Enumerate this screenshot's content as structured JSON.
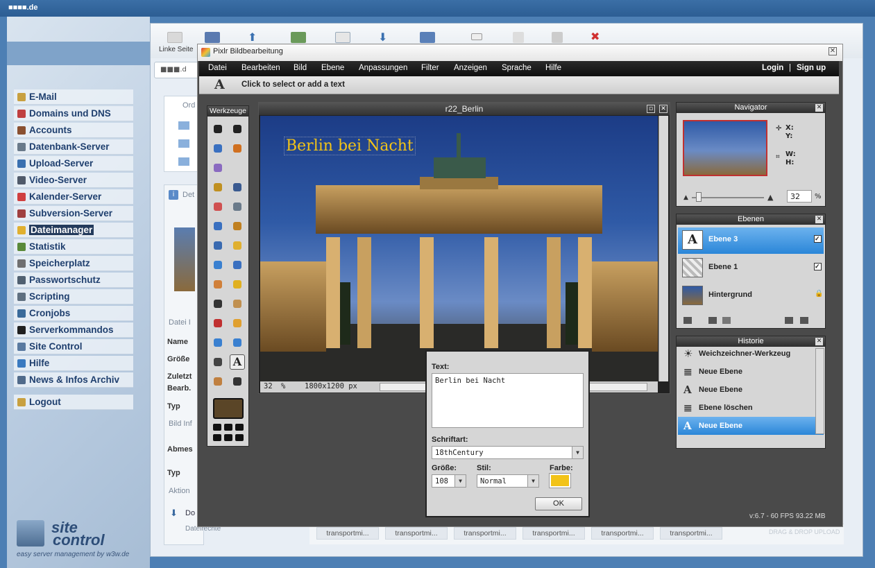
{
  "top_bar": {
    "domain": "■■■■.de"
  },
  "sidebar": {
    "items": [
      {
        "label": "E-Mail",
        "color": "#c8a040"
      },
      {
        "label": "Domains und DNS",
        "color": "#c04040"
      },
      {
        "label": "Accounts",
        "color": "#8a5030"
      },
      {
        "label": "Datenbank-Server",
        "color": "#6a7a8a"
      },
      {
        "label": "Upload-Server",
        "color": "#3a70b0"
      },
      {
        "label": "Video-Server",
        "color": "#505a6a"
      },
      {
        "label": "Kalender-Server",
        "color": "#d04040"
      },
      {
        "label": "Subversion-Server",
        "color": "#a04040"
      },
      {
        "label": "Dateimanager",
        "color": "#e0b030"
      },
      {
        "label": "Statistik",
        "color": "#5a8a3a"
      },
      {
        "label": "Speicherplatz",
        "color": "#707070"
      },
      {
        "label": "Passwortschutz",
        "color": "#506070"
      },
      {
        "label": "Scripting",
        "color": "#607080"
      },
      {
        "label": "Cronjobs",
        "color": "#3a6a9a"
      },
      {
        "label": "Serverkommandos",
        "color": "#202020"
      },
      {
        "label": "Site Control",
        "color": "#5a7aa0"
      },
      {
        "label": "Hilfe",
        "color": "#3a7ac0"
      },
      {
        "label": "News & Infos Archiv",
        "color": "#506a8a"
      }
    ],
    "logout": "Logout",
    "active": "Dateimanager"
  },
  "brand": {
    "line1": "site",
    "line2": "control",
    "tagline": "easy server management by w3w.de"
  },
  "filemanager": {
    "toolbar_label": "Linke Seite",
    "address_value": "■■■.d",
    "folder_label": "Ord",
    "details_label": "Det",
    "file_info": "Datei I",
    "fields": [
      "Name",
      "Größe",
      "Zuletzt",
      "Bearb.",
      "Typ"
    ],
    "image_info": "Bild Inf",
    "abmes": "Abmes",
    "typ2": "Typ",
    "aktion": "Aktion",
    "do": "Do",
    "dateirechte": "Dateirechte",
    "transports": [
      "transportmi...",
      "transportmi...",
      "transportmi...",
      "transportmi...",
      "transportmi...",
      "transportmi..."
    ],
    "dragdrop": "DRAG & DROP UPLOAD"
  },
  "pixlr": {
    "title": "Pixlr Bildbearbeitung",
    "menu": [
      "Datei",
      "Bearbeiten",
      "Bild",
      "Ebene",
      "Anpassungen",
      "Filter",
      "Anzeigen",
      "Sprache",
      "Hilfe"
    ],
    "login": "Login",
    "separator": "|",
    "signup": "Sign up",
    "hint": "Click to select or add a text",
    "tools_title": "Werkzeuge",
    "image_title": "r22_Berlin",
    "overlay_text": "Berlin bei Nacht",
    "zoom": "32",
    "zoom_unit": "%",
    "dimensions": "1800x1200 px",
    "version": "v:6.7 - 60 FPS 93.22 MB",
    "foreground_color": "#5a4527",
    "navigator": {
      "title": "Navigator",
      "x": "X:",
      "y": "Y:",
      "w": "W:",
      "h": "H:",
      "zoom": "32",
      "unit": "%"
    },
    "layers": {
      "title": "Ebenen",
      "items": [
        {
          "name": "Ebene 3",
          "selected": true,
          "icon": "text-icon"
        },
        {
          "name": "Ebene 1",
          "selected": false,
          "icon": "transparent-icon"
        },
        {
          "name": "Hintergrund",
          "selected": false,
          "icon": "image-icon"
        }
      ]
    },
    "history": {
      "title": "Historie",
      "items": [
        {
          "name": "Weichzeichner-Werkzeug",
          "icon": "drop-icon",
          "glyph": "☀"
        },
        {
          "name": "Neue Ebene",
          "icon": "layer-icon",
          "glyph": "≣"
        },
        {
          "name": "Neue Ebene",
          "icon": "text-icon",
          "glyph": "A"
        },
        {
          "name": "Ebene löschen",
          "icon": "layer-icon",
          "glyph": "≣"
        },
        {
          "name": "Neue Ebene",
          "icon": "text-icon",
          "glyph": "A"
        }
      ]
    },
    "text_dialog": {
      "text_label": "Text:",
      "text_value": "Berlin bei Nacht",
      "font_label": "Schriftart:",
      "font_value": "18thCentury",
      "size_label": "Größe:",
      "size_value": "108",
      "style_label": "Stil:",
      "style_value": "Normal",
      "color_label": "Farbe:",
      "color_value": "#f2c318",
      "ok": "OK"
    }
  }
}
